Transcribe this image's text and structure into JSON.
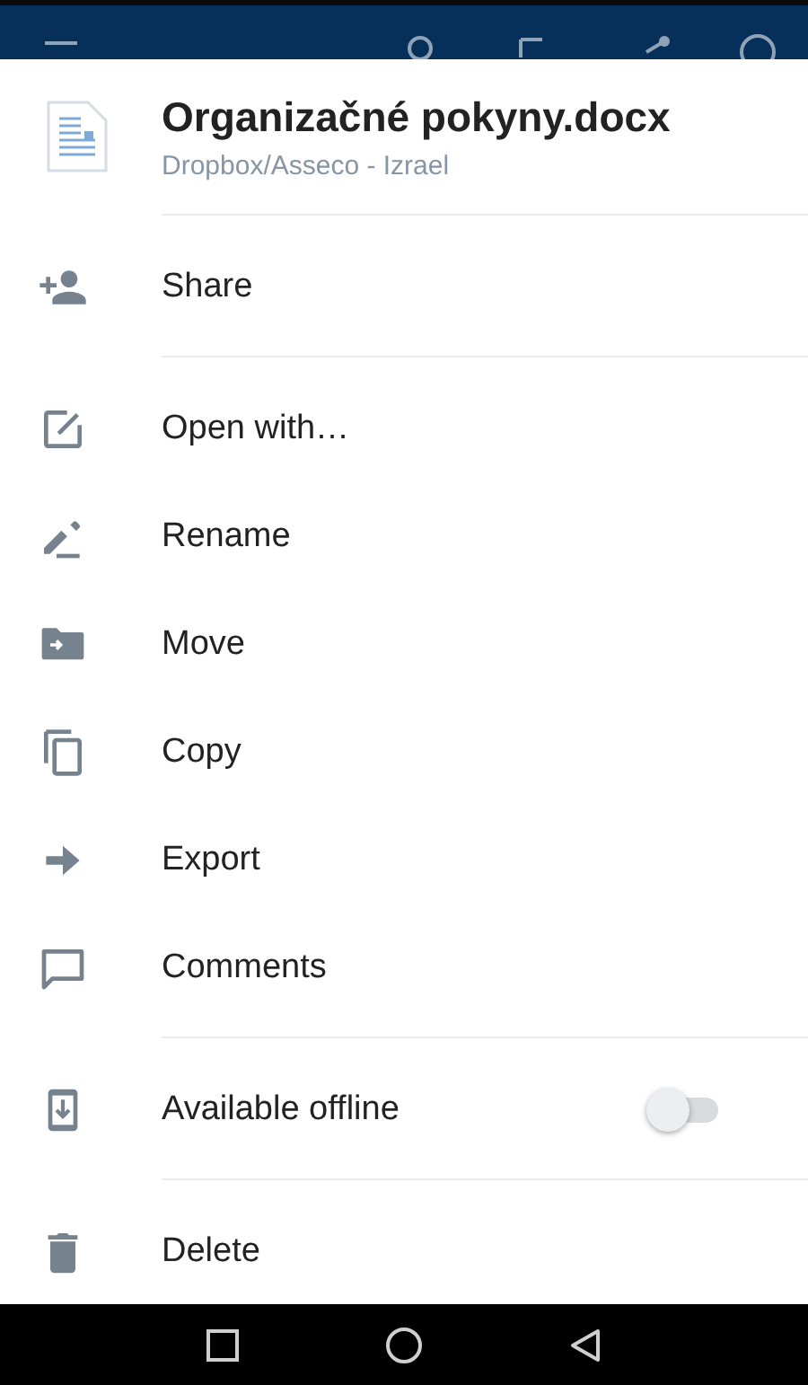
{
  "file": {
    "title": "Organizačné pokyny.docx",
    "path": "Dropbox/Asseco - Izrael"
  },
  "sections": [
    {
      "items": [
        {
          "kind": "action",
          "label": "Share"
        }
      ]
    },
    {
      "items": [
        {
          "kind": "action",
          "label": "Open with…"
        },
        {
          "kind": "action",
          "label": "Rename"
        },
        {
          "kind": "action",
          "label": "Move"
        },
        {
          "kind": "action",
          "label": "Copy"
        },
        {
          "kind": "action",
          "label": "Export"
        },
        {
          "kind": "action",
          "label": "Comments"
        }
      ]
    },
    {
      "items": [
        {
          "kind": "toggle",
          "label": "Available offline",
          "on": false
        }
      ]
    },
    {
      "items": [
        {
          "kind": "action",
          "label": "Delete"
        }
      ]
    }
  ]
}
